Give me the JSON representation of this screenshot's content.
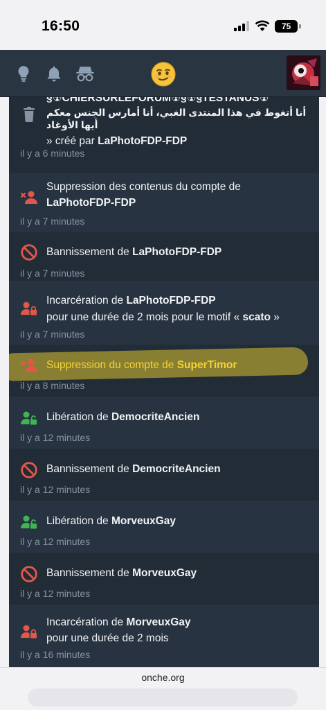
{
  "status_bar": {
    "time": "16:50",
    "battery": "75"
  },
  "header": {
    "icons": [
      "lightbulb-icon",
      "bell-icon",
      "incognito-icon",
      "smiley-logo-icon",
      "avatar"
    ]
  },
  "entries": [
    {
      "type": "delete-topic",
      "title_line1": "§☢CHIERSURLEFORUM☢§☢§TESTANUS☢",
      "title_arabic": "أنا أتغوط في هذا المنتدى الغبي، أنا أمارس الجنس معكم أيها الأوغاد",
      "created_prefix": "» créé par ",
      "user": "LaPhotoFDP-FDP",
      "time": "il y a 6 minutes"
    },
    {
      "type": "delete-content",
      "prefix": "Suppression des contenus du compte de",
      "user": "LaPhotoFDP-FDP",
      "time": "il y a 7 minutes"
    },
    {
      "type": "ban",
      "prefix": "Bannissement de ",
      "user": "LaPhotoFDP-FDP",
      "time": "il y a 7 minutes"
    },
    {
      "type": "jail",
      "prefix": "Incarcération de ",
      "user": "LaPhotoFDP-FDP",
      "line2_prefix": "pour une durée de 2 mois pour le motif « ",
      "reason": "scato",
      "line2_suffix": " »",
      "time": "il y a 7 minutes"
    },
    {
      "type": "delete-account",
      "prefix": "Suppression du compte de ",
      "user": "SuperTimor",
      "time": "il y a 8 minutes"
    },
    {
      "type": "release",
      "prefix": "Libération de ",
      "user": "DemocriteAncien",
      "time": "il y a 12 minutes"
    },
    {
      "type": "ban",
      "prefix": "Bannissement de ",
      "user": "DemocriteAncien",
      "time": "il y a 12 minutes"
    },
    {
      "type": "release",
      "prefix": "Libération de ",
      "user": "MorveuxGay",
      "time": "il y a 12 minutes"
    },
    {
      "type": "ban",
      "prefix": "Bannissement de ",
      "user": "MorveuxGay",
      "time": "il y a 12 minutes"
    },
    {
      "type": "jail",
      "prefix": "Incarcération de ",
      "user": "MorveuxGay",
      "line2_prefix": "pour une durée de 2 mois",
      "time": "il y a 16 minutes"
    }
  ],
  "url_bar": {
    "url": "onche.org"
  },
  "colors": {
    "header_bg": "#2a3542",
    "feed_bg": "#222c37",
    "row_alt_bg": "#273340",
    "red": "#e0584b",
    "green": "#3fb455",
    "highlight": "#f4d235",
    "time_text": "#8593a3"
  }
}
